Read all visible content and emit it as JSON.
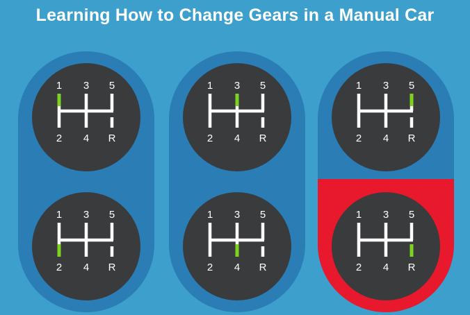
{
  "title": "Learning How to Change Gears in a Manual Car",
  "gear_labels": {
    "top": [
      "1",
      "3",
      "5"
    ],
    "bottom": [
      "2",
      "4",
      "R"
    ]
  },
  "colors": {
    "background": "#3d9fcc",
    "pill": "#2b7db5",
    "highlight_pill": "#e8192c",
    "knob": "#3a3b3d",
    "pattern": "#ffffff",
    "active_gear": "#7ed321"
  },
  "knobs": [
    {
      "id": "knob-gear-1",
      "active": "1"
    },
    {
      "id": "knob-gear-2",
      "active": "2"
    },
    {
      "id": "knob-gear-3",
      "active": "3"
    },
    {
      "id": "knob-gear-4",
      "active": "4"
    },
    {
      "id": "knob-gear-5",
      "active": "5"
    },
    {
      "id": "knob-gear-r",
      "active": "R",
      "highlighted": true
    }
  ]
}
